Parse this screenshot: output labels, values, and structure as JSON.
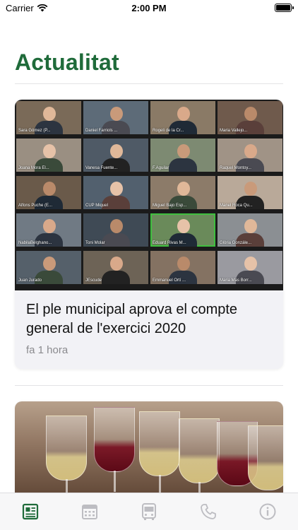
{
  "status_bar": {
    "carrier": "Carrier",
    "time": "2:00 PM"
  },
  "page": {
    "title": "Actualitat"
  },
  "news": [
    {
      "title": "El ple municipal aprova el compte general de l'exercici 2020",
      "time": "fa 1 hora",
      "image_participants": [
        "Sara Gómez (P...",
        "Daniel Farriols ...",
        "Rogeli de la Cr...",
        "Maria Vallejo...",
        "Joana Mora El...",
        "Vanesa Fuente...",
        "F.Aguilar",
        "Raquel Montoy...",
        "Alfons Puche (E...",
        "CUP Miquel",
        "Miguel Bajo Esp...",
        "Manel Roca Qu...",
        "NabilaBelghano...",
        "Toni Molar",
        "Eduard Rivas M...",
        "Glòria Gonzále...",
        "Juan Jurado",
        "JEscude",
        "Emmanuel Ortí ...",
        "Maria Mas Borr..."
      ]
    },
    {
      "title": "",
      "time": ""
    }
  ],
  "tabbar": [
    {
      "icon": "news-icon",
      "active": true
    },
    {
      "icon": "calendar-icon",
      "active": false
    },
    {
      "icon": "bus-icon",
      "active": false
    },
    {
      "icon": "phone-icon",
      "active": false
    },
    {
      "icon": "info-icon",
      "active": false
    }
  ],
  "colors": {
    "accent": "#1f6b3a",
    "inactive_icon": "#bdbdc2"
  }
}
